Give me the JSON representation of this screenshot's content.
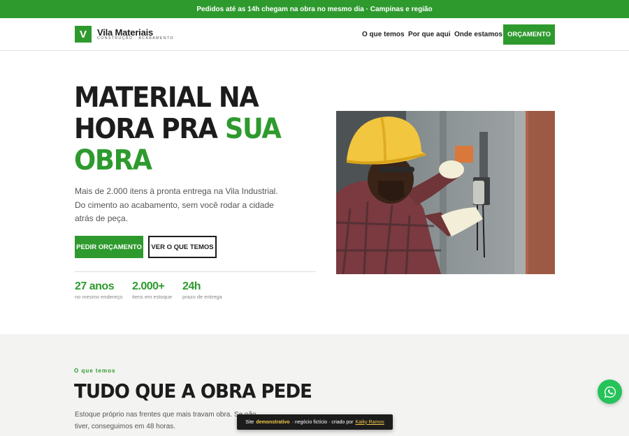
{
  "topbar": {
    "text": "Pedidos até as 14h chegam na obra no mesmo dia · Campinas e região"
  },
  "logo": {
    "letter": "V",
    "name": "Vila Materiais",
    "tagline": "CONSTRUÇÃO · ACABAMENTO"
  },
  "nav": {
    "links": [
      "O que temos",
      "Por que aqui",
      "Onde estamos"
    ],
    "cta": "ORÇAMENTO"
  },
  "hero": {
    "title_line1": "MATERIAL NA",
    "title_line2_a": "HORA PRA ",
    "title_line2_b": "SUA",
    "title_line3": "OBRA",
    "description": "Mais de 2.000 itens à pronta entrega na Vila Industrial. Do cimento ao acabamento, sem você rodar a cidade atrás de peça.",
    "btn_primary": "PEDIR ORÇAMENTO",
    "btn_secondary": "VER O QUE TEMOS",
    "stats": [
      {
        "value": "27 anos",
        "label": "no mesmo endereço"
      },
      {
        "value": "2.000+",
        "label": "itens em estoque"
      },
      {
        "value": "24h",
        "label": "prazo de entrega"
      }
    ]
  },
  "section": {
    "eyebrow": "O que temos",
    "title": "TUDO QUE A OBRA PEDE",
    "description": "Estoque próprio nas frentes que mais travam obra. Se não tiver, conseguimos em 48 horas."
  },
  "demo_bar": {
    "prefix": "Site",
    "highlight": "demonstrativo",
    "middle": "· negócio fictício · criado por",
    "author": "Kaiky Ramos"
  },
  "colors": {
    "accent": "#2e9a2e",
    "dark": "#1c1c1c",
    "whatsapp": "#25c35a"
  },
  "icons": {
    "whatsapp": "whatsapp-icon"
  }
}
